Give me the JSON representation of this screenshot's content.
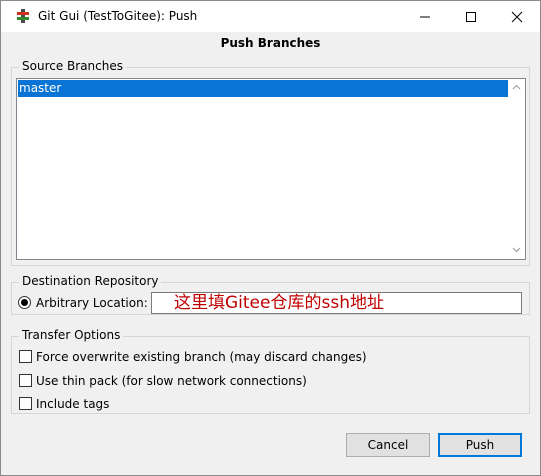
{
  "window": {
    "title": "Git Gui (TestToGitee): Push",
    "icon": "git-gui-icon"
  },
  "heading": "Push Branches",
  "source": {
    "label": "Source Branches",
    "branches": [
      "master"
    ],
    "selected": "master"
  },
  "destination": {
    "label": "Destination Repository",
    "option_label": "Arbitrary Location:",
    "location_value": "这里填Gitee仓库的ssh地址"
  },
  "transfer": {
    "label": "Transfer Options",
    "options": [
      {
        "label": "Force overwrite existing branch (may discard changes)",
        "checked": false
      },
      {
        "label": "Use thin pack (for slow network connections)",
        "checked": false
      },
      {
        "label": "Include tags",
        "checked": false
      }
    ]
  },
  "buttons": {
    "cancel": "Cancel",
    "push": "Push"
  },
  "colors": {
    "selection": "#0a74d4",
    "location_text": "#c00000",
    "default_button_border": "#0078d7"
  }
}
